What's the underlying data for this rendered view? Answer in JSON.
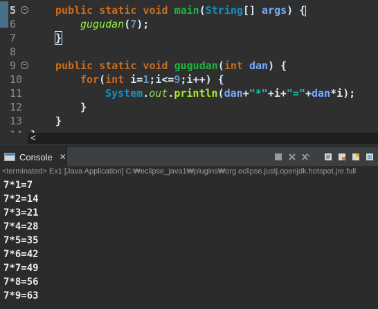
{
  "editor": {
    "lines": [
      {
        "num": "5",
        "fold": true,
        "active": true
      },
      {
        "num": "6"
      },
      {
        "num": "7"
      },
      {
        "num": "8"
      },
      {
        "num": "9",
        "fold": true
      },
      {
        "num": "10"
      },
      {
        "num": "11"
      },
      {
        "num": "12"
      },
      {
        "num": "13"
      },
      {
        "num": "14"
      }
    ],
    "code": {
      "l5": {
        "kw1": "public static void ",
        "fn": "main",
        "p1": "(",
        "ty": "String",
        "br": "[] ",
        "par": "args",
        "p2": ") {"
      },
      "l6": {
        "call": "gugudan",
        "p1": "(",
        "num": "7",
        "p2": ");"
      },
      "l7": {
        "brace": "}"
      },
      "l9": {
        "kw1": "public static void ",
        "fn": "gugudan",
        "p1": "(",
        "kw2": "int ",
        "par": "dan",
        "p2": ") {"
      },
      "l10": {
        "kw": "for",
        "p1": "(",
        "kw2": "int ",
        "v1": "i",
        "t1": "=",
        "n1": "1",
        "t2": ";",
        "v2": "i",
        "t3": "<=",
        "n2": "9",
        "t4": ";",
        "v3": "i",
        "t5": "++) {"
      },
      "l11": {
        "cls": "System",
        "dot1": ".",
        "ref": "out",
        "dot2": ".",
        "meth": "println",
        "p1": "(",
        "par1": "dan",
        "plus1": "+",
        "s1": "\"*\"",
        "plus2": "+",
        "v1": "i",
        "plus3": "+",
        "s2": "\"=\"",
        "plus4": "+",
        "par2": "dan",
        "mul": "*",
        "v2": "i",
        "p2": ");"
      },
      "l12": {
        "brace": "}"
      },
      "l13": {
        "brace": "}"
      },
      "l14": {
        "brace": "}"
      }
    },
    "scroll_left": "<"
  },
  "console": {
    "tab_label": "Console",
    "tab_close": "✕",
    "status": "<terminated> Ex1 [Java Application] C:₩eclipse_java1₩plugins₩org.eclipse.justj.openjdk.hotspot.jre.full",
    "output": [
      "7*1=7",
      "7*2=14",
      "7*3=21",
      "7*4=28",
      "7*5=35",
      "7*6=42",
      "7*7=49",
      "7*8=56",
      "7*9=63"
    ],
    "tools": [
      "stop-icon",
      "remove-launch-icon",
      "remove-all-icon",
      "scroll-lock-icon",
      "word-wrap-icon",
      "pin-icon",
      "open-console-icon"
    ]
  },
  "colors": {
    "editor_bg": "#2f2f2f",
    "keyword": "#cc6c1d",
    "method_decl": "#1eb540",
    "type": "#1290c3",
    "parameter": "#79abff",
    "string": "#17c6a3",
    "console_bg": "#2b2b2b"
  }
}
